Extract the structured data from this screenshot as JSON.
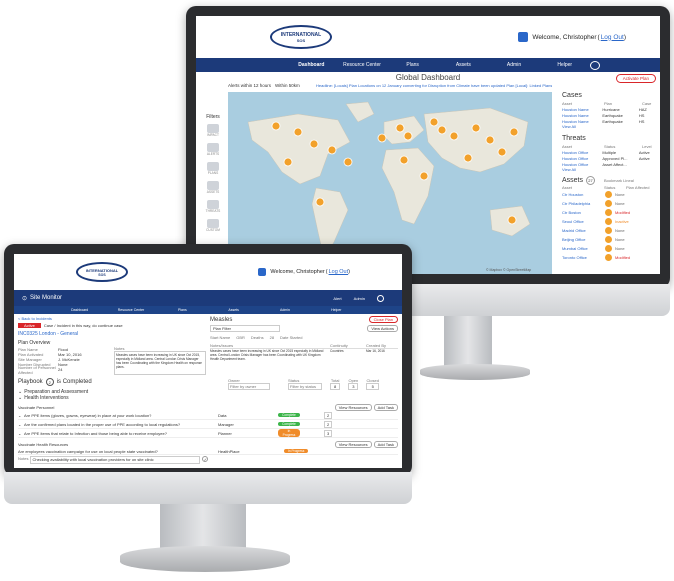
{
  "back_screen": {
    "logo": {
      "line1": "INTERNATIONAL",
      "line2": "SOS"
    },
    "welcome_prefix": "Welcome, Christopher",
    "logout_label": "Log Out",
    "nav": [
      "Dashboard",
      "Resource Center",
      "Plans",
      "Assets",
      "Admin",
      "Helper"
    ],
    "page_title": "Global Dashboard",
    "alerts_filter": "Alerts within 12 hours",
    "within_filter": "Within 50km",
    "ticker": "Headline: [Locals] Plan Locations on 12 January converting for Disruption from Climate have been updated   Plan [Local]: Linked Plans",
    "activate_button": "Activate Plan",
    "filters_label": "Filters",
    "filter_icons": [
      "IMPACT",
      "ALERTS",
      "PLANS",
      "ASSETS",
      "THREATS",
      "CUSTOM"
    ],
    "cases": {
      "title": "Cases",
      "headers": [
        "Asset",
        "Plan",
        "Case"
      ],
      "rows": [
        [
          "Houston Name",
          "Hurricane",
          "HAZ"
        ],
        [
          "Houston Name",
          "Earthquake",
          "HS"
        ],
        [
          "Houston Name",
          "Earthquake",
          "HS"
        ]
      ],
      "view_all": "View All"
    },
    "threats": {
      "title": "Threats",
      "headers": [
        "Asset",
        "Status",
        "Level"
      ],
      "rows": [
        [
          "Houston Office",
          "Multiple",
          "Active"
        ],
        [
          "Houston Office",
          "Approved Pl...",
          "Active"
        ],
        [
          "Houston Office",
          "Asset Affect...",
          ""
        ]
      ],
      "view_all": "View All"
    },
    "assets": {
      "title": "Assets",
      "count": "27",
      "toggle": "Bookmark  Lineal",
      "headers": [
        "Asset",
        "Status",
        "Plan Affected"
      ],
      "rows": [
        [
          "Ctr Houston",
          "None"
        ],
        [
          "Ctr Philadelphia",
          "None"
        ],
        [
          "Ctr Boston",
          "Modified"
        ],
        [
          "Seoul Office",
          "Inactive"
        ],
        [
          "Madrid Office",
          "None"
        ],
        [
          "Beijing Office",
          "None"
        ],
        [
          "Mumbai Office",
          "None"
        ],
        [
          "Toronto Office",
          "Modified"
        ]
      ]
    },
    "map_credit": "© Mapbox © OpenStreetMap"
  },
  "front_screen": {
    "logo": {
      "line1": "INTERNATIONAL",
      "line2": "SOS"
    },
    "welcome_prefix": "Welcome, Christopher",
    "logout_label": "Log Out",
    "app_title": "Site Monitor",
    "header_actions": [
      "Alert",
      "Admin"
    ],
    "tabs": [
      "Dashboard",
      "Resource Center",
      "Plans",
      "Assets",
      "Admin",
      "Helper"
    ],
    "back_link": "< Back to Incidents",
    "status_badge": "Active",
    "status_note": "Case / Incident in this way, do continue case",
    "case_id": "INC0325 London - General",
    "plan_overview": "Plan Overview",
    "plan_fields": [
      [
        "Plan Name",
        "Flood"
      ],
      [
        "Plan Activated",
        "Mar 10, 2016"
      ],
      [
        "Site Manager",
        "J. McKenzie"
      ],
      [
        "Number Disrupted",
        "None"
      ],
      [
        "Number of Personnel Affected",
        "24"
      ]
    ],
    "notes_label": "Notes",
    "notes_text": "Measles cases have been increasing in UK since Oct 2015, especially in Midland area. Central London Crisis Manager has been Coordinating with the Kingdom Health on response plans.",
    "measles_title": "Measles",
    "plan_filter": "Plan Filter",
    "info_headers": [
      "Start Name",
      "GBR",
      "Deaths",
      "28",
      "Date Started"
    ],
    "edit_button": "View Actions",
    "close_plan": "Close Plan",
    "table_headers": [
      "Notes/Issues",
      "Continuity",
      "Created By"
    ],
    "table_row": [
      "Measles cases have been increasing in UK since Oct 2015 especially in Midland area. Central London Crisis Manager has been Coordinating with UK Kingdom Health Department team.",
      "Countries",
      "Mar 16, 2016"
    ],
    "playbook_title": "Playbook",
    "playbook_count": "2",
    "playbook_status": "is Completed",
    "owner_label": "Owner",
    "owner_value": "Filter by owner",
    "status_label": "Status",
    "status_value": "Filter by status",
    "counters": [
      [
        "Total",
        "8"
      ],
      [
        "Open",
        "3"
      ],
      [
        "Closed",
        "5"
      ]
    ],
    "section_prep": "Preparation and Assessment",
    "section_health": "Health Interventions",
    "subsection": "Vaccinate Personnel",
    "sub_buttons": [
      "View Resources",
      "Add Task"
    ],
    "tasks": [
      {
        "text": "Are PPE items (gloves, gowns, eyewear) in place at your work location?",
        "owner": "Data",
        "status": "Complete",
        "color": "#3cb54a",
        "count": "2"
      },
      {
        "text": "Are the confirmed plans located in the proper use of PPE according to local regulations?",
        "owner": "Manager",
        "status": "Complete",
        "color": "#3cb54a",
        "count": "2"
      },
      {
        "text": "Are PPE items that relate to Infection and those being able to receive employee?",
        "owner": "Planner",
        "status": "In Progress",
        "color": "#f08c2a",
        "count": "3"
      }
    ],
    "subsection2": "Vaccinate Health Resources",
    "sub_buttons2": [
      "View Resources",
      "Add Task"
    ],
    "task4": {
      "text": "Are employees vaccination campaign for use on local people state vaccinated?",
      "owner": "HealthPlace",
      "status": "In Progress",
      "color": "#f08c2a"
    },
    "comment_label": "Notes",
    "comment_text": "Checking availability with local vaccination providers for on site clinic"
  },
  "colors": {
    "nav_blue": "#1c3a7a",
    "accent_red": "#d9262a",
    "ocean": "#a9cde0",
    "land": "#e9e7dc",
    "marker": "#f2a12b"
  }
}
